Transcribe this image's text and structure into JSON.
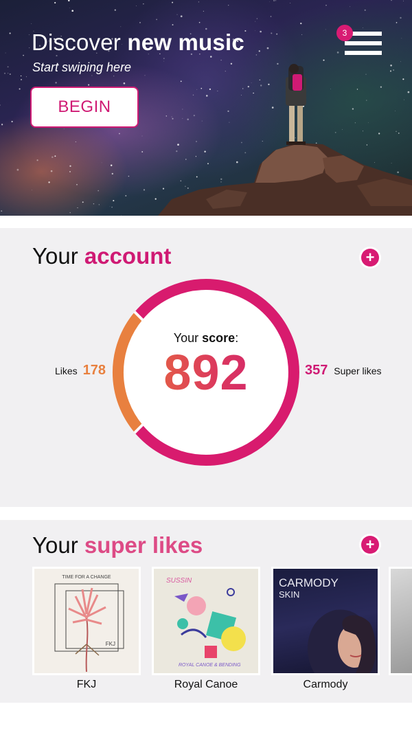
{
  "hero": {
    "title_light": "Discover",
    "title_bold": "new music",
    "subtitle": "Start swiping here",
    "begin_label": "BEGIN",
    "menu_badge": "3"
  },
  "account": {
    "title_plain": "Your",
    "title_highlight": "account",
    "score_label_plain": "Your",
    "score_label_bold": "score",
    "score_label_colon": ":",
    "score": "892",
    "likes_label": "Likes",
    "likes": "178",
    "super_likes": "357",
    "super_likes_label": "Super likes",
    "colors": {
      "likes": "#e8803f",
      "super_likes": "#cf1a74"
    }
  },
  "super_likes": {
    "title_plain": "Your",
    "title_highlight": "super likes",
    "albums": [
      {
        "name": "FKJ",
        "cover_text": "TIME FOR A CHANGE",
        "cover_sub": "FKJ"
      },
      {
        "name": "Royal Canoe",
        "cover_text": "SUSSIN",
        "cover_sub": "ROYAL CANOE & BENDING"
      },
      {
        "name": "Carmody",
        "cover_text": "CARMODY",
        "cover_sub": "SKIN"
      }
    ]
  },
  "icons": {
    "plus": "+",
    "menu": "hamburger-menu-icon"
  },
  "colors": {
    "brand": "#cf1a74",
    "accent": "#e8723a",
    "panel": "#f1f0f2"
  }
}
